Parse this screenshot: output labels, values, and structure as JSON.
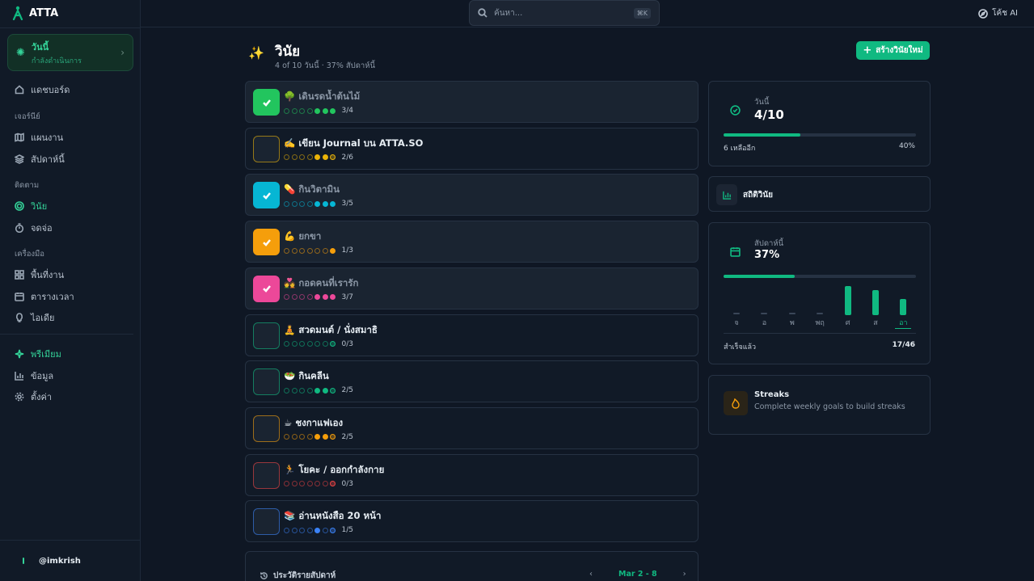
{
  "app": {
    "name": "ATTA"
  },
  "search": {
    "placeholder": "ค้นหา...",
    "shortcut": "⌘K"
  },
  "topbar": {
    "ask_ai": "โค้ช AI"
  },
  "sidebar": {
    "today": {
      "title": "วันนี้",
      "subtitle": "กำลังดำเนินการ"
    },
    "dashboard": "แดชบอร์ด",
    "sections": {
      "journey": {
        "label": "เจอร์นีย์",
        "items": [
          "แผนงาน",
          "สัปดาห์นี้"
        ]
      },
      "tracking": {
        "label": "ติดตาม",
        "items": [
          "วินัย",
          "จดจ่อ"
        ]
      },
      "tools": {
        "label": "เครื่องมือ",
        "items": [
          "พื้นที่งาน",
          "ตารางเวลา",
          "ไอเดีย"
        ]
      }
    },
    "premium": "พรีเมียม",
    "data": "ข้อมูล",
    "settings": "ตั้งค่า",
    "user": "@imkrish"
  },
  "page": {
    "title": "วินัย",
    "subtitle": "4 of 10 วันนี้ · 37% สัปดาห์นี้",
    "create_label": "สร้างวินัยใหม่"
  },
  "habits": [
    {
      "emoji": "🌳",
      "name": "เดินรดน้ำต้นไม้",
      "count": "3/4",
      "done": true,
      "color": "#22c55e",
      "filled": [
        0,
        0,
        0,
        0,
        1,
        1,
        1
      ]
    },
    {
      "emoji": "✍️",
      "name": "เขียน Journal บน ATTA.SO",
      "count": "2/6",
      "done": false,
      "color": "#eab308",
      "filled": [
        0,
        0,
        0,
        0,
        1,
        1,
        2
      ]
    },
    {
      "emoji": "💊",
      "name": "กินวิตามิน",
      "count": "3/5",
      "done": true,
      "color": "#06b6d4",
      "filled": [
        0,
        0,
        0,
        0,
        1,
        1,
        1
      ]
    },
    {
      "emoji": "💪",
      "name": "ยกขา",
      "count": "1/3",
      "done": true,
      "color": "#f59e0b",
      "filled": [
        0,
        0,
        0,
        0,
        0,
        0,
        1
      ]
    },
    {
      "emoji": "💑",
      "name": "กอดคนที่เรารัก",
      "count": "3/7",
      "done": true,
      "color": "#ec4899",
      "filled": [
        0,
        0,
        0,
        0,
        1,
        1,
        1
      ]
    },
    {
      "emoji": "🧘",
      "name": "สวดมนต์ / นั่งสมาธิ",
      "count": "0/3",
      "done": false,
      "color": "#10b981",
      "filled": [
        0,
        0,
        0,
        0,
        0,
        0,
        2
      ]
    },
    {
      "emoji": "🥗",
      "name": "กินคลีน",
      "count": "2/5",
      "done": false,
      "color": "#10b981",
      "filled": [
        0,
        0,
        0,
        0,
        1,
        1,
        2
      ]
    },
    {
      "emoji": "☕",
      "name": "ชงกาแฟเอง",
      "count": "2/5",
      "done": false,
      "color": "#f59e0b",
      "filled": [
        0,
        0,
        0,
        0,
        1,
        1,
        2
      ]
    },
    {
      "emoji": "🏃",
      "name": "โยคะ / ออกกำลังกาย",
      "count": "0/3",
      "done": false,
      "color": "#ef4444",
      "filled": [
        0,
        0,
        0,
        0,
        0,
        0,
        2
      ]
    },
    {
      "emoji": "📚",
      "name": "อ่านหนังสือ 20 หน้า",
      "count": "1/5",
      "done": false,
      "color": "#3b82f6",
      "filled": [
        0,
        0,
        0,
        0,
        1,
        0,
        2
      ]
    }
  ],
  "history": {
    "label": "ประวัติรายสัปดาห์",
    "range": "Mar 2 - 8",
    "prev": "‹",
    "next": "›"
  },
  "today_card": {
    "label": "วันนี้",
    "value": "4/10",
    "remaining": "6 เหลืออีก",
    "percent": "40%",
    "progress": 0.4
  },
  "stats": {
    "label": "สถิติวินัย"
  },
  "week_card": {
    "label": "สัปดาห์นี้",
    "value": "37%",
    "progress": 0.37,
    "days": [
      "จ",
      "อ",
      "พ",
      "พฤ",
      "ศ",
      "ส",
      "อา"
    ],
    "day_values": [
      0,
      0,
      0,
      0,
      1.0,
      0.85,
      0.55
    ],
    "completed_label": "สำเร็จแล้ว",
    "completed_value": "17/46"
  },
  "streaks": {
    "title": "Streaks",
    "desc": "Complete weekly goals to build streaks"
  },
  "colors": {
    "accent": "#10b981",
    "bg": "#0f1724",
    "card": "#111a27",
    "border": "#263243"
  }
}
